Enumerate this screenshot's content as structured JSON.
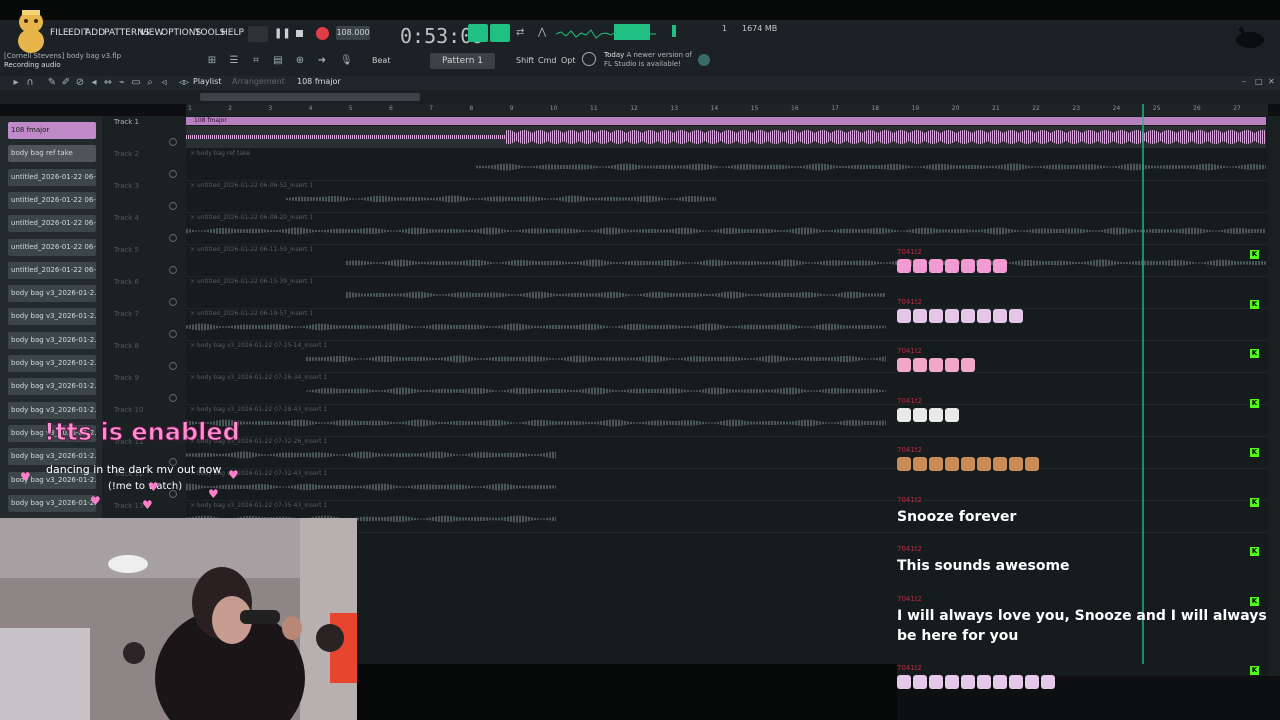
{
  "colors": {
    "accent_green": "#1fc081",
    "record_red": "#e03d45",
    "pink_clip": "#b97fbf",
    "kick_badge": "#53fc18"
  },
  "header": {
    "project_name": "[Cornell Stevens] body bag v3.flp",
    "status": "Recording audio",
    "menu": [
      "FILE",
      "EDIT",
      "ADD",
      "PATTERNS",
      "VIEW",
      "OPTIONS",
      "TOOLS",
      "HELP"
    ],
    "tempo": "108.000",
    "time": "0:53:09",
    "memory": "1674 MB",
    "cpu": "1",
    "pattern": "Pattern 1",
    "snap": "Beat",
    "mod_buttons": [
      "Shift",
      "Cmd",
      "Opt"
    ],
    "news_title": "Today",
    "news_line1": "A newer version of",
    "news_line2": "FL Studio is available!"
  },
  "playlist": {
    "title": "Playlist",
    "subtitle": "Arrangement",
    "pattern": "108 fmajor",
    "ruler": [
      "1",
      "2",
      "3",
      "4",
      "5",
      "6",
      "7",
      "8",
      "9",
      "10",
      "11",
      "12",
      "13",
      "14",
      "15",
      "16",
      "17",
      "18",
      "19",
      "20",
      "21",
      "22",
      "23",
      "24",
      "25",
      "26",
      "27"
    ]
  },
  "channels": [
    "108 fmajor",
    "body bag ref take",
    "untitled_2026-01-22 06-...",
    "untitled_2026-01-22 06-...",
    "untitled_2026-01-22 06-...",
    "untitled_2026-01-22 06-...",
    "untitled_2026-01-22 06-...",
    "body bag v3_2026-01-2...",
    "body bag v3_2026-01-2...",
    "body bag v3_2026-01-2...",
    "body bag v3_2026-01-2...",
    "body bag v3_2026-01-2...",
    "body bag v3_2026-01-2...",
    "body bag v3_2026-01-2...",
    "body bag v3_2026-01-2...",
    "body bag v3_2026-01-2...",
    "body bag v3_2026-01-2..."
  ],
  "tracks": [
    {
      "label": "Track 1",
      "clip": "108 fmajor"
    },
    {
      "label": "Track 2",
      "clip": "body bag ref take"
    },
    {
      "label": "Track 3",
      "clip": "untitled_2026-01-22 06-06-52_Insert 1"
    },
    {
      "label": "Track 4",
      "clip": "untitled_2026-01-22 06-08-20_Insert 1"
    },
    {
      "label": "Track 5",
      "clip": "untitled_2026-01-22 06-11-59_Insert 1"
    },
    {
      "label": "Track 6",
      "clip": "untitled_2026-01-22 06-15-39_Insert 1"
    },
    {
      "label": "Track 7",
      "clip": "untitled_2026-01-22 06-19-57_Insert 1"
    },
    {
      "label": "Track 8",
      "clip": "body bag v3_2026-01-22 07-25-14_Insert 1"
    },
    {
      "label": "Track 9",
      "clip": "body bag v3_2026-01-22 07-26-34_Insert 1"
    },
    {
      "label": "Track 10",
      "clip": "body bag v3_2026-01-22 07-28-43_Insert 1"
    },
    {
      "label": "Track 11",
      "clip": "body bag v3_2026-01-22 07-32-26_Insert 1"
    },
    {
      "label": "Track 12",
      "clip": "body bag v3_2026-01-22 07-32-43_Insert 1"
    },
    {
      "label": "Track 13",
      "clip": "body bag v3_2026-01-22 07-35-43_Insert 1"
    }
  ],
  "overlay": {
    "tts": "!tts is enabled",
    "mv_line1": "dancing in the dark mv out now",
    "mv_line2": "(!me to watch)"
  },
  "chat": [
    {
      "user": "7041t2",
      "emote_color": "#f29bd2",
      "emote_count": 7,
      "text": ""
    },
    {
      "user": "7041t2",
      "emote_color": "#e6c7e8",
      "emote_count": 8,
      "text": ""
    },
    {
      "user": "7041t2",
      "emote_color": "#f0a7c8",
      "emote_count": 5,
      "text": ""
    },
    {
      "user": "7041t2",
      "emote_color": "#e9e9e9",
      "emote_count": 4,
      "text": ""
    },
    {
      "user": "7041t2",
      "emote_color": "#c98b57",
      "emote_count": 9,
      "text": ""
    },
    {
      "user": "7041t2",
      "text": "Snooze forever"
    },
    {
      "user": "7041t2",
      "text": "This sounds awesome"
    },
    {
      "user": "7041t2",
      "text": "I will always love you, Snooze and I will always be here for you"
    },
    {
      "user": "7041t2",
      "emote_color": "#e6c7e8",
      "emote_count": 10,
      "text": ""
    }
  ]
}
